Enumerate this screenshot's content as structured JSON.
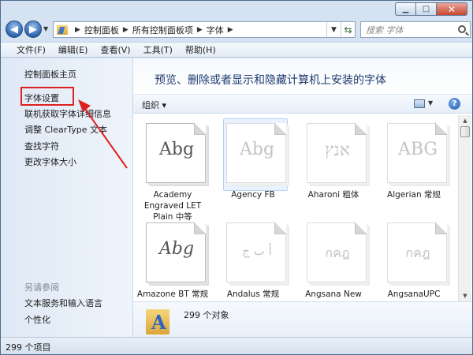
{
  "nav": {
    "crumbs": [
      "控制面板",
      "所有控制面板项",
      "字体"
    ],
    "search_placeholder": "搜索 字体"
  },
  "menu": [
    "文件(F)",
    "编辑(E)",
    "查看(V)",
    "工具(T)",
    "帮助(H)"
  ],
  "left_pane": {
    "home": "控制面板主页",
    "links": [
      "字体设置",
      "联机获取字体详细信息",
      "调整 ClearType 文本",
      "查找字符",
      "更改字体大小"
    ],
    "see_also_title": "另请参阅",
    "see_also": [
      "文本服务和输入语言",
      "个性化"
    ]
  },
  "main": {
    "title": "预览、删除或者显示和隐藏计算机上安装的字体",
    "organize": "组织",
    "fonts": [
      {
        "glyph": "Abg",
        "label": "Academy Engraved LET Plain 中等"
      },
      {
        "glyph": "Abg",
        "label": "Agency FB"
      },
      {
        "glyph": "אנץ",
        "label": "Aharoni 粗体"
      },
      {
        "glyph": "ABG",
        "label": "Algerian 常规"
      },
      {
        "glyph": "Abg",
        "label": "Amazone BT 常规"
      },
      {
        "glyph": "أ ب ج",
        "label": "Andalus 常规"
      },
      {
        "glyph": "กคฎ",
        "label": "Angsana New"
      },
      {
        "glyph": "กคฎ",
        "label": "AngsanaUPC"
      }
    ],
    "details_count": "299 个对象"
  },
  "status": "299 个项目",
  "colors": {
    "title_blue": "#1e3b70",
    "highlight_red": "#e02020"
  }
}
